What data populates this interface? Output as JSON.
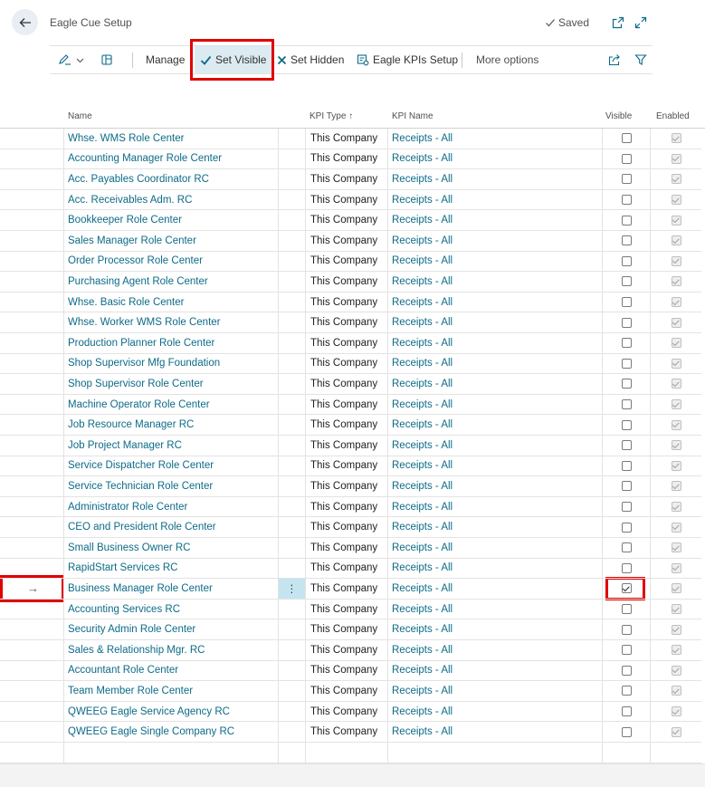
{
  "header": {
    "title": "Eagle Cue Setup",
    "saved_label": "Saved"
  },
  "actions": {
    "manage": "Manage",
    "set_visible": "Set Visible",
    "set_hidden": "Set Hidden",
    "kpis_setup": "Eagle KPIs Setup",
    "more_options": "More options"
  },
  "columns": {
    "name": "Name",
    "kpi_type": "KPI Type",
    "kpi_type_sort": "↑",
    "kpi_name": "KPI Name",
    "visible": "Visible",
    "enabled": "Enabled"
  },
  "rows": [
    {
      "name": "Whse. WMS Role Center",
      "kpi_type": "This Company",
      "kpi_name": "Receipts - All",
      "visible": false,
      "enabled": true
    },
    {
      "name": "Accounting Manager Role Center",
      "kpi_type": "This Company",
      "kpi_name": "Receipts - All",
      "visible": false,
      "enabled": true
    },
    {
      "name": "Acc. Payables Coordinator RC",
      "kpi_type": "This Company",
      "kpi_name": "Receipts - All",
      "visible": false,
      "enabled": true
    },
    {
      "name": "Acc. Receivables Adm. RC",
      "kpi_type": "This Company",
      "kpi_name": "Receipts - All",
      "visible": false,
      "enabled": true
    },
    {
      "name": "Bookkeeper Role Center",
      "kpi_type": "This Company",
      "kpi_name": "Receipts - All",
      "visible": false,
      "enabled": true
    },
    {
      "name": "Sales Manager Role Center",
      "kpi_type": "This Company",
      "kpi_name": "Receipts - All",
      "visible": false,
      "enabled": true
    },
    {
      "name": "Order Processor Role Center",
      "kpi_type": "This Company",
      "kpi_name": "Receipts - All",
      "visible": false,
      "enabled": true
    },
    {
      "name": "Purchasing Agent Role Center",
      "kpi_type": "This Company",
      "kpi_name": "Receipts - All",
      "visible": false,
      "enabled": true
    },
    {
      "name": "Whse. Basic Role Center",
      "kpi_type": "This Company",
      "kpi_name": "Receipts - All",
      "visible": false,
      "enabled": true
    },
    {
      "name": "Whse. Worker WMS Role Center",
      "kpi_type": "This Company",
      "kpi_name": "Receipts - All",
      "visible": false,
      "enabled": true
    },
    {
      "name": "Production Planner Role Center",
      "kpi_type": "This Company",
      "kpi_name": "Receipts - All",
      "visible": false,
      "enabled": true
    },
    {
      "name": "Shop Supervisor Mfg Foundation",
      "kpi_type": "This Company",
      "kpi_name": "Receipts - All",
      "visible": false,
      "enabled": true
    },
    {
      "name": "Shop Supervisor Role Center",
      "kpi_type": "This Company",
      "kpi_name": "Receipts - All",
      "visible": false,
      "enabled": true
    },
    {
      "name": "Machine Operator Role Center",
      "kpi_type": "This Company",
      "kpi_name": "Receipts - All",
      "visible": false,
      "enabled": true
    },
    {
      "name": "Job Resource Manager RC",
      "kpi_type": "This Company",
      "kpi_name": "Receipts - All",
      "visible": false,
      "enabled": true
    },
    {
      "name": "Job Project Manager RC",
      "kpi_type": "This Company",
      "kpi_name": "Receipts - All",
      "visible": false,
      "enabled": true
    },
    {
      "name": "Service Dispatcher Role Center",
      "kpi_type": "This Company",
      "kpi_name": "Receipts - All",
      "visible": false,
      "enabled": true
    },
    {
      "name": "Service Technician Role Center",
      "kpi_type": "This Company",
      "kpi_name": "Receipts - All",
      "visible": false,
      "enabled": true
    },
    {
      "name": "Administrator Role Center",
      "kpi_type": "This Company",
      "kpi_name": "Receipts - All",
      "visible": false,
      "enabled": true
    },
    {
      "name": "CEO and President Role Center",
      "kpi_type": "This Company",
      "kpi_name": "Receipts - All",
      "visible": false,
      "enabled": true
    },
    {
      "name": "Small Business Owner RC",
      "kpi_type": "This Company",
      "kpi_name": "Receipts - All",
      "visible": false,
      "enabled": true
    },
    {
      "name": "RapidStart Services RC",
      "kpi_type": "This Company",
      "kpi_name": "Receipts - All",
      "visible": false,
      "enabled": true
    },
    {
      "name": "Business Manager Role Center",
      "kpi_type": "This Company",
      "kpi_name": "Receipts - All",
      "visible": true,
      "enabled": true,
      "active": true
    },
    {
      "name": "Accounting Services RC",
      "kpi_type": "This Company",
      "kpi_name": "Receipts - All",
      "visible": false,
      "enabled": true
    },
    {
      "name": "Security Admin Role Center",
      "kpi_type": "This Company",
      "kpi_name": "Receipts - All",
      "visible": false,
      "enabled": true
    },
    {
      "name": "Sales & Relationship Mgr. RC",
      "kpi_type": "This Company",
      "kpi_name": "Receipts - All",
      "visible": false,
      "enabled": true
    },
    {
      "name": "Accountant Role Center",
      "kpi_type": "This Company",
      "kpi_name": "Receipts - All",
      "visible": false,
      "enabled": true
    },
    {
      "name": "Team Member Role Center",
      "kpi_type": "This Company",
      "kpi_name": "Receipts - All",
      "visible": false,
      "enabled": true
    },
    {
      "name": "QWEEG Eagle Service Agency RC",
      "kpi_type": "This Company",
      "kpi_name": "Receipts - All",
      "visible": false,
      "enabled": true
    },
    {
      "name": "QWEEG Eagle Single Company RC",
      "kpi_type": "This Company",
      "kpi_name": "Receipts - All",
      "visible": false,
      "enabled": true
    }
  ],
  "row_actions": {
    "active_arrow": "→",
    "more_dots": "⋮"
  },
  "icons": {
    "back": "back-arrow-icon",
    "saved": "checkmark-icon",
    "open_new": "open-in-new-window-icon",
    "expand": "expand-icon",
    "share": "share-icon",
    "filter": "filter-icon"
  }
}
